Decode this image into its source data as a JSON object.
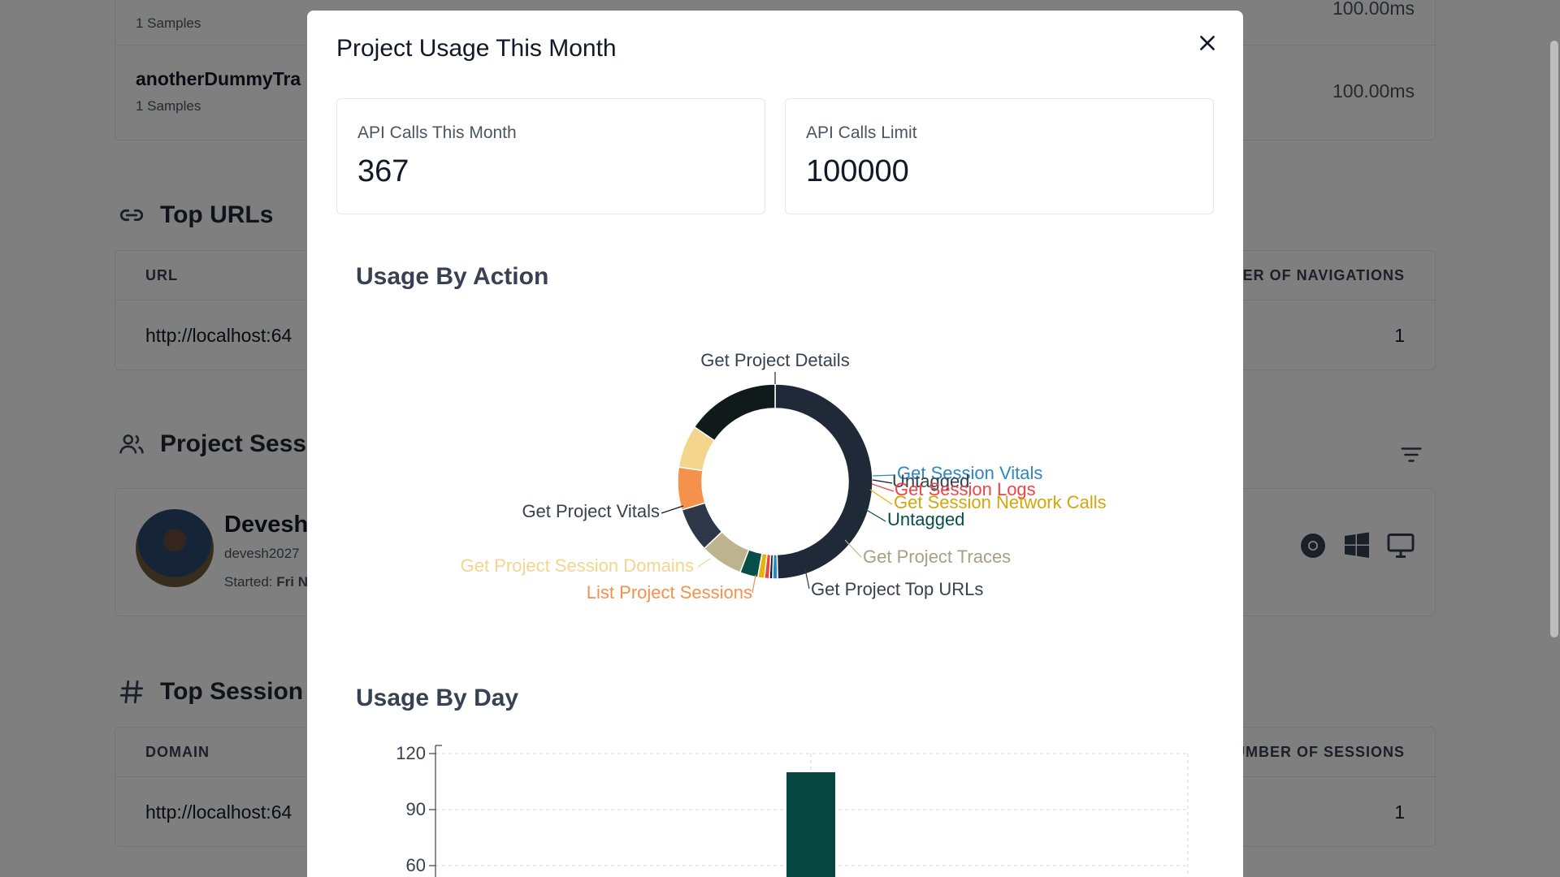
{
  "background": {
    "traces": [
      {
        "name": "",
        "samples": "1 Samples",
        "value": "100.00ms"
      },
      {
        "name": "anotherDummyTra",
        "samples": "1 Samples",
        "value": "100.00ms"
      }
    ],
    "top_urls": {
      "title": "Top URLs",
      "col_left": "URL",
      "col_right": "BER OF NAVIGATIONS",
      "row_url": "http://localhost:64",
      "row_value": "1"
    },
    "sessions": {
      "title": "Project Sessic",
      "user_name": "Devesh",
      "user_email": "devesh2027",
      "started_label": "Started:",
      "started_value": "Fri N"
    },
    "top_domains": {
      "title": "Top Session D",
      "col_left": "DOMAIN",
      "col_right": "UMBER OF SESSIONS",
      "row_url": "http://localhost:64",
      "row_value": "1"
    }
  },
  "modal": {
    "title": "Project Usage This Month",
    "stats": [
      {
        "label": "API Calls This Month",
        "value": "367"
      },
      {
        "label": "API Calls Limit",
        "value": "100000"
      }
    ],
    "usage_by_action_title": "Usage By Action",
    "usage_by_day_title": "Usage By Day"
  },
  "chart_data": [
    {
      "type": "pie",
      "title": "Usage By Action",
      "series": [
        {
          "name": "Get Project Details",
          "value": 182,
          "color": "#1f2937",
          "label_color": "#374151"
        },
        {
          "name": "Get Session Vitals",
          "value": 3,
          "color": "#2e86c1",
          "label_color": "#2e86c1"
        },
        {
          "name": "Untagged",
          "value": 2,
          "color": "#111827",
          "label_color": "#374151"
        },
        {
          "name": "Get Session Logs",
          "value": 3,
          "color": "#ef4444",
          "label_color": "#ef4444"
        },
        {
          "name": "Get Session Network Calls",
          "value": 4,
          "color": "#eab308",
          "label_color": "#d4a60a"
        },
        {
          "name": "Untagged",
          "value": 11,
          "color": "#064e48",
          "label_color": "#064e48"
        },
        {
          "name": "Get Project Traces",
          "value": 26,
          "color": "#bdb48f",
          "label_color": "#a8a080"
        },
        {
          "name": "Get Project Top URLs",
          "value": 27,
          "color": "#2d3748",
          "label_color": "#374151"
        },
        {
          "name": "List Project Sessions",
          "value": 26,
          "color": "#f4914d",
          "label_color": "#f4914d"
        },
        {
          "name": "Get Project Session Domains",
          "value": 26,
          "color": "#f4d58d",
          "label_color": "#f4d58d"
        },
        {
          "name": "Get Project Vitals",
          "value": 57,
          "color": "#111a1a",
          "label_color": "#374151"
        }
      ]
    },
    {
      "type": "bar",
      "title": "Usage By Day",
      "ylim": [
        0,
        120
      ],
      "yticks": [
        120,
        90,
        60
      ],
      "categories": [
        "",
        ""
      ],
      "values": [
        0,
        110
      ],
      "color": "#06473f"
    }
  ]
}
